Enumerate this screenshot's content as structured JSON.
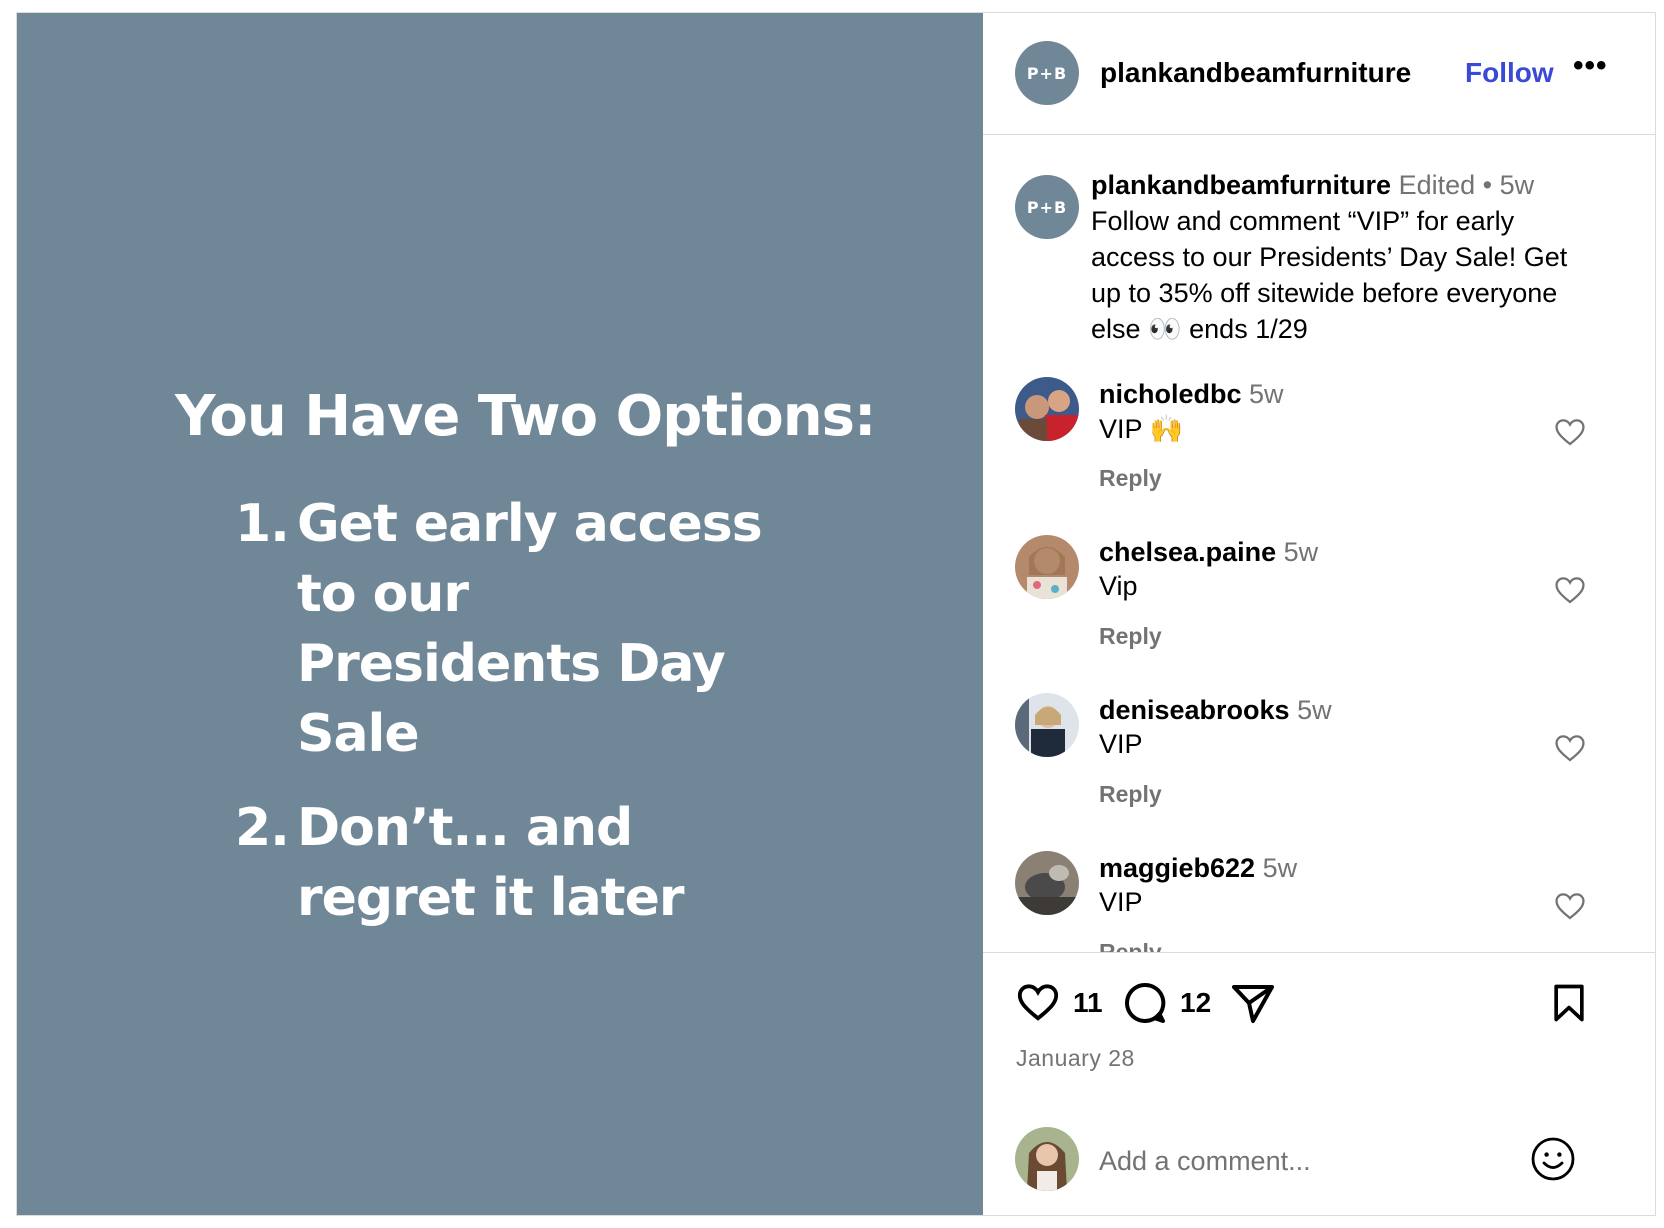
{
  "media": {
    "heading": "You Have Two Options:",
    "options": [
      {
        "num": "1.",
        "text": "Get early access to our Presidents Day Sale"
      },
      {
        "num": "2.",
        "text": "Don’t... and regret it later"
      }
    ]
  },
  "header": {
    "avatar_text": "P+B",
    "username": "plankandbeamfurniture",
    "follow_label": "Follow",
    "more_label": "•••"
  },
  "caption": {
    "avatar_text": "P+B",
    "username": "plankandbeamfurniture",
    "edited": "Edited",
    "dot": "•",
    "time": "5w",
    "text": "Follow and comment “VIP” for early access to our Presidents’ Day Sale! Get up to 35% off sitewide before everyone else 👀 ends 1/29"
  },
  "comments": [
    {
      "username": "nicholedbc",
      "time": "5w",
      "text": "VIP 🙌",
      "reply": "Reply",
      "avatar_color": "#8b6a55"
    },
    {
      "username": "chelsea.paine",
      "time": "5w",
      "text": "Vip",
      "reply": "Reply",
      "avatar_color": "#c49a7c"
    },
    {
      "username": "deniseabrooks",
      "time": "5w",
      "text": "VIP",
      "reply": "Reply",
      "avatar_color": "#4a5566"
    },
    {
      "username": "maggieb622",
      "time": "5w",
      "text": "VIP",
      "reply": "Reply",
      "avatar_color": "#6b6660"
    }
  ],
  "actions": {
    "like_count": "11",
    "comment_count": "12",
    "date": "January 28"
  },
  "add_comment": {
    "placeholder": "Add a comment...",
    "avatar_color": "#7a5a44"
  },
  "colors": {
    "media_bg": "#6f8796",
    "link_blue": "#3a49d6",
    "secondary_text": "#737373",
    "divider": "#dbdbdb"
  }
}
